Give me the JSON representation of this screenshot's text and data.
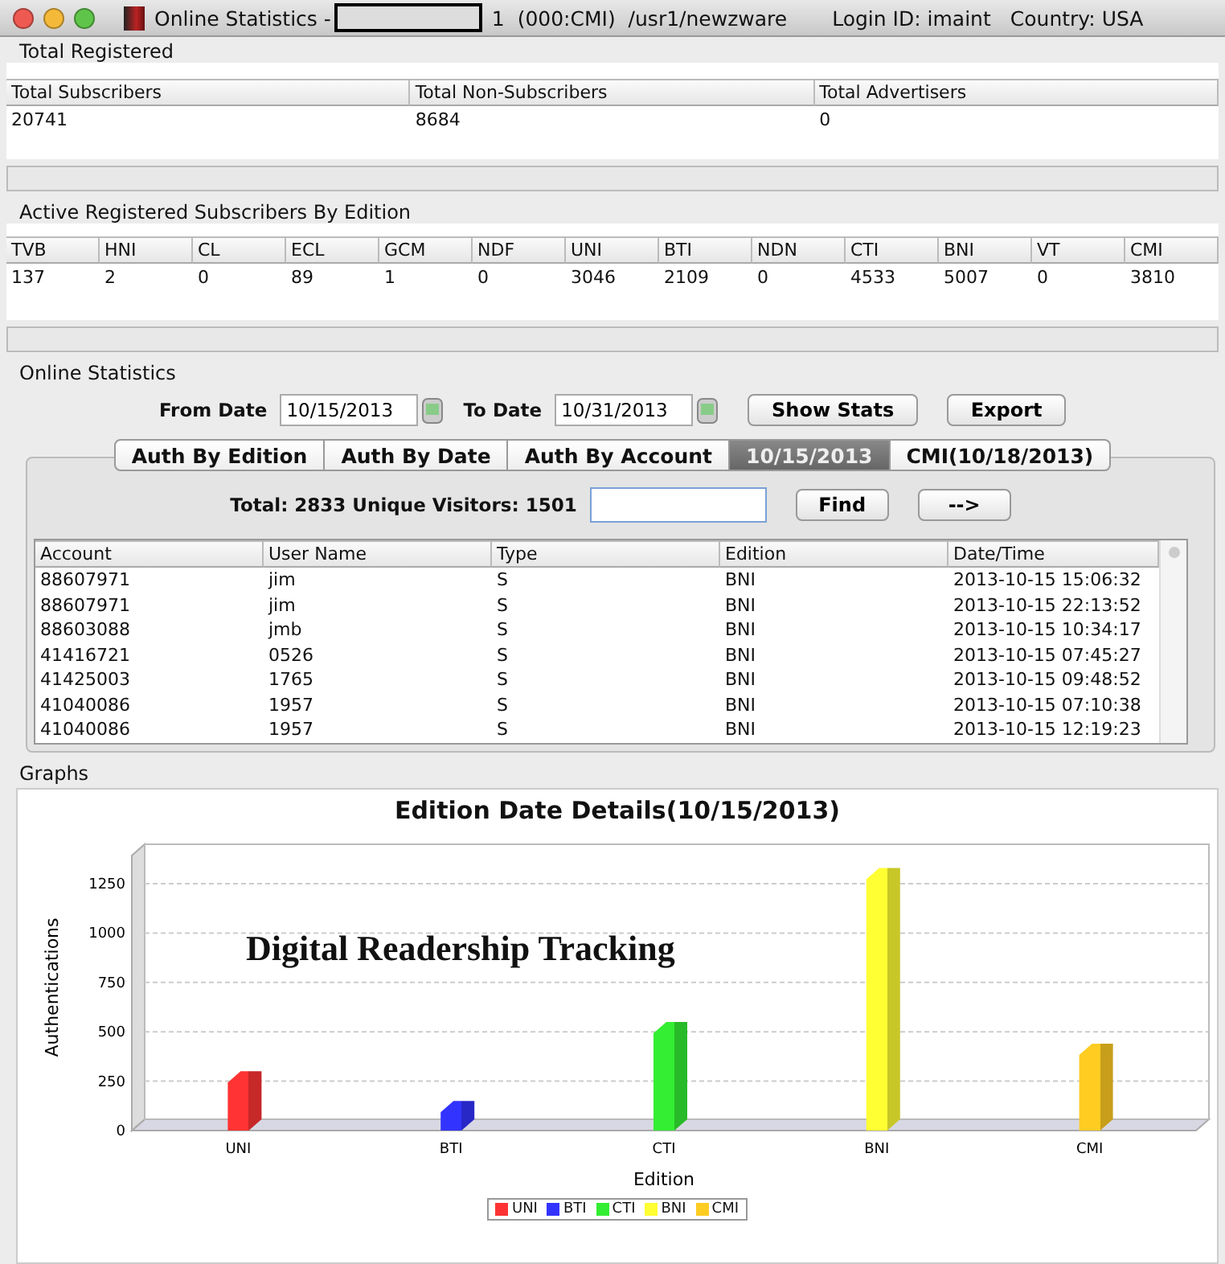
{
  "window": {
    "title_prefix": "Online Statistics -",
    "title_suffix": "1  (000:CMI)  /usr1/newzware",
    "login": "Login ID: imaint",
    "country": "Country: USA"
  },
  "total_registered": {
    "title": "Total Registered",
    "columns": [
      "Total Subscribers",
      "Total Non-Subscribers",
      "Total Advertisers"
    ],
    "values": [
      "20741",
      "8684",
      "0"
    ]
  },
  "by_edition": {
    "title": "Active Registered Subscribers By Edition",
    "columns": [
      "TVB",
      "HNI",
      "CL",
      "ECL",
      "GCM",
      "NDF",
      "UNI",
      "BTI",
      "NDN",
      "CTI",
      "BNI",
      "VT",
      "CMI"
    ],
    "values": [
      "137",
      "2",
      "0",
      "89",
      "1",
      "0",
      "3046",
      "2109",
      "0",
      "4533",
      "5007",
      "0",
      "3810"
    ]
  },
  "online": {
    "title": "Online Statistics",
    "from_label": "From Date",
    "from_value": "10/15/2013",
    "to_label": "To Date",
    "to_value": "10/31/2013",
    "buttons": [
      "Show Stats",
      "Export"
    ],
    "tabs": [
      {
        "label": "Auth By Edition",
        "selected": false
      },
      {
        "label": "Auth By Date",
        "selected": false
      },
      {
        "label": "Auth By Account",
        "selected": false
      },
      {
        "label": "10/15/2013",
        "selected": true
      },
      {
        "label": "CMI(10/18/2013)",
        "selected": false
      }
    ],
    "summary": "Total: 2833 Unique Visitors: 1501",
    "find_button": "Find",
    "next_button": "-->",
    "table": {
      "columns": [
        "Account",
        "User Name",
        "Type",
        "Edition",
        "Date/Time"
      ],
      "rows": [
        [
          "88607971",
          "jim",
          "S",
          "BNI",
          "2013-10-15 15:06:32"
        ],
        [
          "88607971",
          "jim",
          "S",
          "BNI",
          "2013-10-15 22:13:52"
        ],
        [
          "88603088",
          "jmb",
          "S",
          "BNI",
          "2013-10-15 10:34:17"
        ],
        [
          "41416721",
          "0526",
          "S",
          "BNI",
          "2013-10-15 07:45:27"
        ],
        [
          "41425003",
          "1765",
          "S",
          "BNI",
          "2013-10-15 09:48:52"
        ],
        [
          "41040086",
          "1957",
          "S",
          "BNI",
          "2013-10-15 07:10:38"
        ],
        [
          "41040086",
          "1957",
          "S",
          "BNI",
          "2013-10-15 12:19:23"
        ]
      ]
    }
  },
  "graphs": {
    "title": "Graphs",
    "overlay_caption": "Digital Readership Tracking",
    "chart_data": {
      "type": "bar",
      "title": "Edition Date Details(10/15/2013)",
      "xlabel": "Edition",
      "ylabel": "Authentications",
      "categories": [
        "UNI",
        "BTI",
        "CTI",
        "BNI",
        "CMI"
      ],
      "ylim": [
        0,
        1450
      ],
      "grid": true,
      "yticks": [
        0,
        250,
        500,
        750,
        1000,
        1250
      ],
      "values": [
        300,
        150,
        550,
        1330,
        440
      ]
    },
    "legend": [
      {
        "name": "UNI",
        "color": "#ff3333"
      },
      {
        "name": "BTI",
        "color": "#3333ff"
      },
      {
        "name": "CTI",
        "color": "#33ee33"
      },
      {
        "name": "BNI",
        "color": "#ffff33"
      },
      {
        "name": "CMI",
        "color": "#ffcc22"
      }
    ]
  }
}
